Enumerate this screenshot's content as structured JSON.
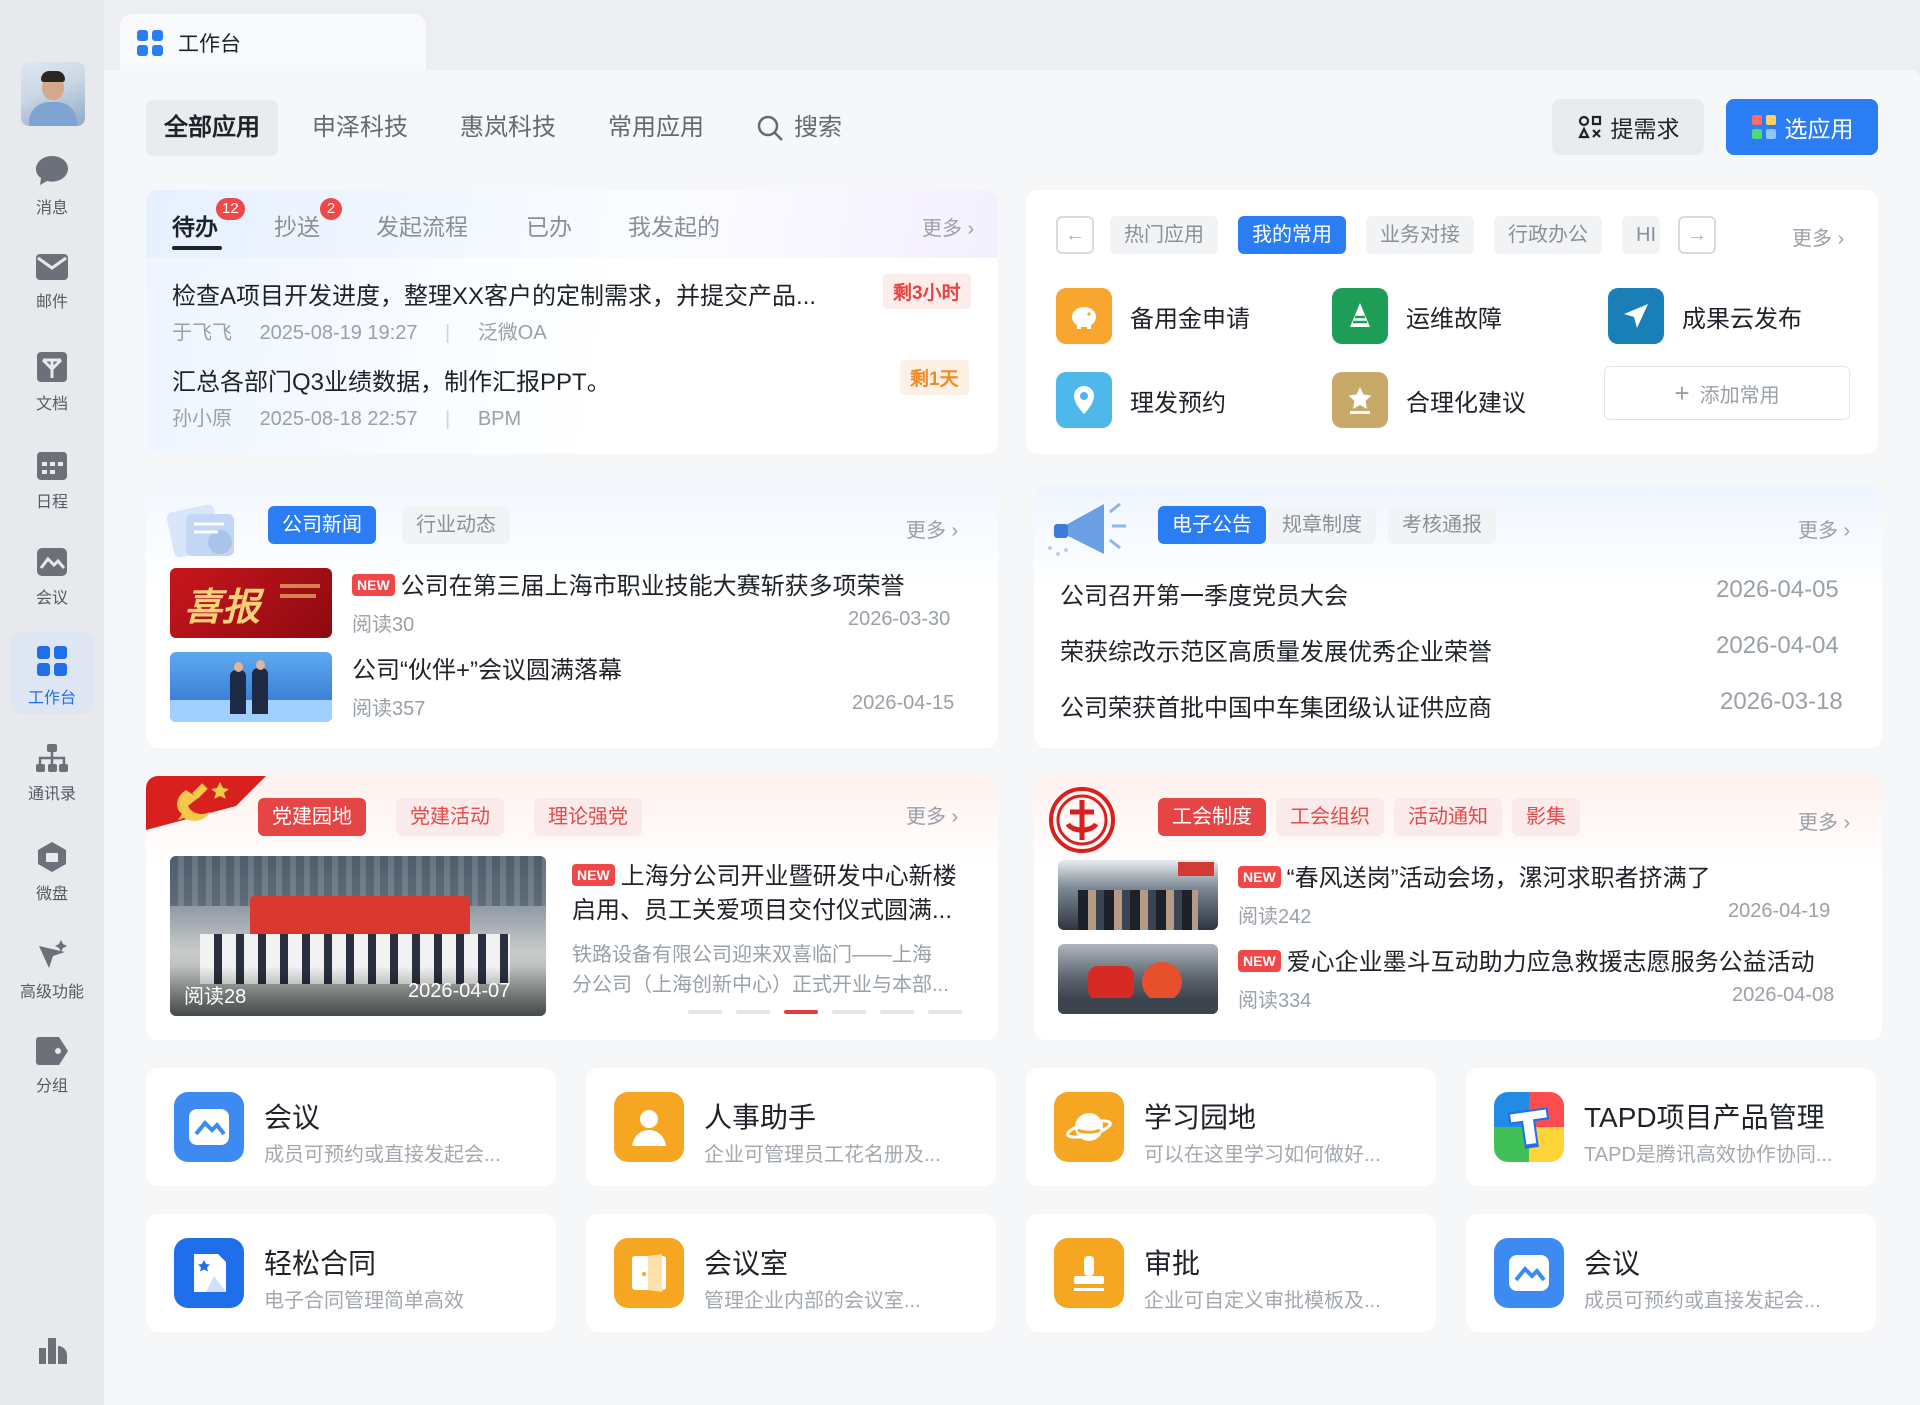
{
  "window": {
    "tab_title": "工作台"
  },
  "sidebar": {
    "items": [
      {
        "label": "消息",
        "icon": "chat-icon"
      },
      {
        "label": "邮件",
        "icon": "mail-icon"
      },
      {
        "label": "文档",
        "icon": "doc-icon"
      },
      {
        "label": "日程",
        "icon": "calendar-icon"
      },
      {
        "label": "会议",
        "icon": "meeting-icon"
      },
      {
        "label": "工作台",
        "icon": "workbench-icon",
        "active": true
      },
      {
        "label": "通讯录",
        "icon": "contacts-icon"
      },
      {
        "label": "微盘",
        "icon": "drive-icon"
      },
      {
        "label": "高级功能",
        "icon": "advanced-icon"
      },
      {
        "label": "分组",
        "icon": "tag-icon"
      }
    ]
  },
  "topnav": {
    "tabs": [
      "全部应用",
      "申泽科技",
      "惠岚科技",
      "常用应用"
    ],
    "search_label": "搜索",
    "request_label": "提需求",
    "choose_label": "选应用"
  },
  "todo": {
    "tabs": [
      "待办",
      "抄送",
      "发起流程",
      "已办",
      "我发起的"
    ],
    "badges": [
      "12",
      "2"
    ],
    "more": "更多",
    "items": [
      {
        "title": "检查A项目开发进度，整理XX客户的定制需求，并提交产品...",
        "tag": "剩3小时",
        "person": "于飞飞",
        "time": "2025-08-19 19:27",
        "source": "泛微OA"
      },
      {
        "title": "汇总各部门Q3业绩数据，制作汇报PPT。",
        "tag": "剩1天",
        "person": "孙小原",
        "time": "2025-08-18 22:57",
        "source": "BPM"
      }
    ]
  },
  "quick": {
    "pills": [
      "热门应用",
      "我的常用",
      "业务对接",
      "行政办公",
      "HI"
    ],
    "more": "更多",
    "apps": [
      "备用金申请",
      "运维故障",
      "成果云发布",
      "理发预约",
      "合理化建议"
    ],
    "add_label": "添加常用"
  },
  "news": {
    "pills": [
      "公司新闻",
      "行业动态"
    ],
    "more": "更多",
    "new_tag": "NEW",
    "items": [
      {
        "title": "公司在第三届上海市职业技能大赛斩获多项荣誉",
        "reads": "阅读30",
        "date": "2026-03-30"
      },
      {
        "title": "公司“伙伴+”会议圆满落幕",
        "reads": "阅读357",
        "date": "2026-04-15"
      }
    ],
    "thumb_text": "喜报"
  },
  "notice": {
    "pills": [
      "电子公告",
      "规章制度",
      "考核通报"
    ],
    "more": "更多",
    "items": [
      {
        "title": "公司召开第一季度党员大会",
        "date": "2026-04-05"
      },
      {
        "title": "荣获综改示范区高质量发展优秀企业荣誉",
        "date": "2026-04-04"
      },
      {
        "title": "公司荣获首批中国中车集团级认证供应商",
        "date": "2026-03-18"
      }
    ]
  },
  "party": {
    "pills": [
      "党建园地",
      "党建活动",
      "理论强党"
    ],
    "more": "更多",
    "new_tag": "NEW",
    "title_line1": "上海分公司开业暨研发中心新楼",
    "title_line2": "启用、员工关爱项目交付仪式圆满...",
    "desc_line1": "铁路设备有限公司迎来双喜临门——上海",
    "desc_line2": "分公司（上海创新中心）正式开业与本部...",
    "image_reads": "阅读28",
    "image_date": "2026-04-07"
  },
  "union": {
    "pills": [
      "工会制度",
      "工会组织",
      "活动通知",
      "影集"
    ],
    "more": "更多",
    "new_tag": "NEW",
    "items": [
      {
        "title": "“春风送岗”活动会场，漯河求职者挤满了",
        "reads": "阅读242",
        "date": "2026-04-19"
      },
      {
        "title": "爱心企业墨斗互动助力应急救援志愿服务公益活动",
        "reads": "阅读334",
        "date": "2026-04-08"
      }
    ]
  },
  "apps": [
    {
      "title": "会议",
      "sub": "成员可预约或直接发起会...",
      "color": "#3d8bf0"
    },
    {
      "title": "人事助手",
      "sub": "企业可管理员工花名册及...",
      "color": "#f5a623"
    },
    {
      "title": "学习园地",
      "sub": "可以在这里学习如何做好...",
      "color": "#f5a623"
    },
    {
      "title": "TAPD项目产品管理",
      "sub": "TAPD是腾讯高效协作协同...",
      "color": "#1f6feb"
    },
    {
      "title": "轻松合同",
      "sub": "电子合同管理简单高效",
      "color": "#1f6feb"
    },
    {
      "title": "会议室",
      "sub": "管理企业内部的会议室...",
      "color": "#f5a623"
    },
    {
      "title": "审批",
      "sub": "企业可自定义审批模板及...",
      "color": "#f5a623"
    },
    {
      "title": "会议",
      "sub": "成员可预约或直接发起会...",
      "color": "#3d8bf0"
    }
  ]
}
